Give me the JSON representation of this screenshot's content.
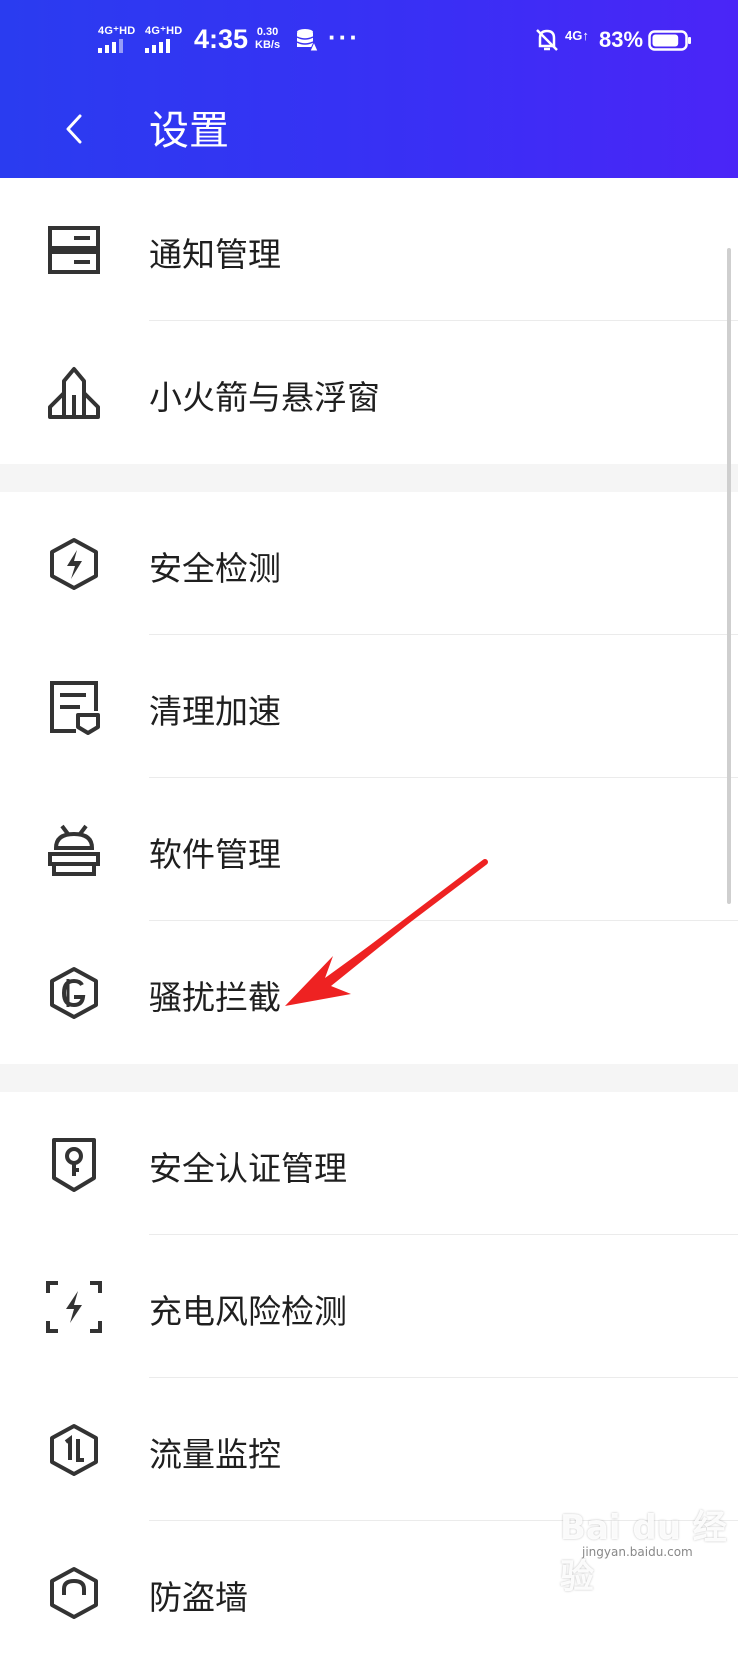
{
  "status_bar": {
    "sim1": "4G⁺HD",
    "sim2": "4G⁺HD",
    "time": "4:35",
    "speed_value": "0.30",
    "speed_unit": "KB/s",
    "more": "···",
    "network": "4G↑",
    "battery": "83%",
    "battery_level": 0.83
  },
  "header": {
    "title": "设置"
  },
  "menu": [
    {
      "label": "通知管理",
      "icon": "notification-list-icon"
    },
    {
      "label": "小火箭与悬浮窗",
      "icon": "rocket-icon"
    },
    {
      "label": "安全检测",
      "icon": "shield-bolt-icon"
    },
    {
      "label": "清理加速",
      "icon": "clean-document-icon"
    },
    {
      "label": "软件管理",
      "icon": "android-robot-icon"
    },
    {
      "label": "骚扰拦截",
      "icon": "block-shield-icon"
    },
    {
      "label": "安全认证管理",
      "icon": "key-shield-icon"
    },
    {
      "label": "充电风险检测",
      "icon": "charge-scan-icon"
    },
    {
      "label": "流量监控",
      "icon": "traffic-monitor-icon"
    },
    {
      "label": "防盗墙",
      "icon": "anti-theft-icon"
    }
  ],
  "watermark": {
    "brand": "Bai du 经验",
    "url": "jingyan.baidu.com"
  }
}
